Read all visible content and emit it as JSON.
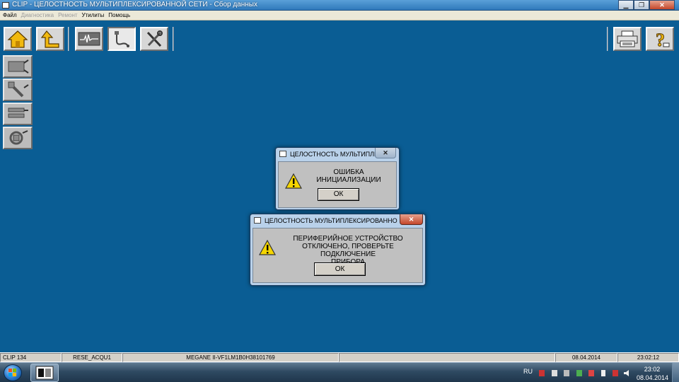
{
  "window": {
    "title": "CLIP - ЦЕЛОСТНОСТЬ МУЛЬТИПЛЕКСИРОВАННОЙ СЕТИ - Сбор данных",
    "controls": [
      "minimize-icon",
      "maximize-icon",
      "close-icon"
    ]
  },
  "menu": {
    "items": [
      {
        "label": "Файл",
        "enabled": true
      },
      {
        "label": "Диагностика",
        "enabled": false
      },
      {
        "label": "Ремонт",
        "enabled": false
      },
      {
        "label": "Утилиты",
        "enabled": true
      },
      {
        "label": "Помощь",
        "enabled": true
      }
    ]
  },
  "toolbar": {
    "left_buttons": [
      "home-icon",
      "up-arrow-icon",
      "waveform-icon",
      "cable-icon",
      "tools-icon"
    ],
    "right_buttons": [
      "printer-icon",
      "help-icon"
    ]
  },
  "sidebar": {
    "buttons": [
      "sidebar-tool-1-icon",
      "sidebar-tool-2-icon",
      "sidebar-tool-3-icon",
      "sidebar-tool-4-icon"
    ]
  },
  "dialogs": [
    {
      "title": "ЦЕЛОСТНОСТЬ МУЛЬТИПЛЕ...",
      "message_lines": [
        "ОШИБКА",
        "ИНИЦИАЛИЗАЦИИ"
      ],
      "ok_label": "ОК",
      "icon": "warning-icon"
    },
    {
      "title": "ЦЕЛОСТНОСТЬ МУЛЬТИПЛЕКСИРОВАННОЙ С...",
      "message_lines": [
        "ПЕРИФЕРИЙНОЕ УСТРОЙСТВО",
        "ОТКЛЮЧЕНО, ПРОВЕРЬТЕ ПОДКЛЮЧЕНИЕ",
        "ПРИБОРА"
      ],
      "ok_label": "ОК",
      "icon": "warning-icon"
    }
  ],
  "statusbar": {
    "cells": [
      "CLIP 134",
      "RESE_ACQU1",
      "MEGANE II-VF1LM1B0H38101769",
      "",
      "08.04.2014",
      "23:02:12"
    ]
  },
  "taskbar": {
    "language": "RU",
    "time": "23:02",
    "date": "08.04.2014"
  },
  "colors": {
    "desktop": "#0a5d94",
    "warning": "#f5d500",
    "close_red": "#c4472b"
  }
}
